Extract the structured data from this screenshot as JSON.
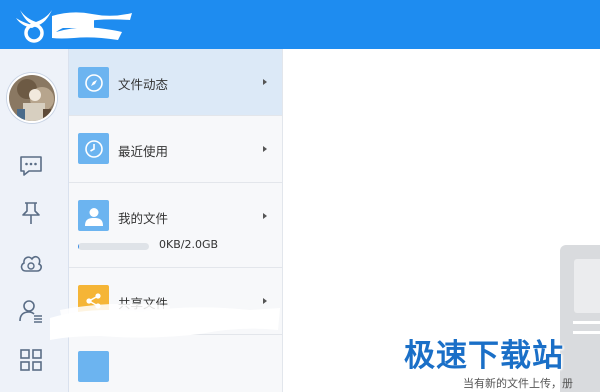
{
  "colors": {
    "accent": "#1e8cf0",
    "tile_blue": "#6cb4f0",
    "tile_orange": "#f5b536",
    "active_item_bg": "#dce9f7",
    "watermark": "#1a6fc7"
  },
  "header": {
    "logo_icon": "wings-logo-icon",
    "redacted_title": ""
  },
  "rail": {
    "avatar": "user-avatar",
    "buttons": [
      {
        "icon": "message-icon"
      },
      {
        "icon": "pin-icon"
      },
      {
        "icon": "cloud-icon"
      },
      {
        "icon": "contacts-icon"
      },
      {
        "icon": "apps-grid-icon"
      }
    ]
  },
  "menu": {
    "items": [
      {
        "label": "文件动态",
        "icon": "compass-icon",
        "active": true
      },
      {
        "label": "最近使用",
        "icon": "clock-icon",
        "active": false
      },
      {
        "label": "我的文件",
        "icon": "user-icon",
        "active": false
      },
      {
        "label": "共享文件",
        "icon": "share-icon",
        "active": false
      }
    ],
    "storage": {
      "usage_text": "0KB/2.0GB",
      "fraction_used": 0.02
    }
  },
  "main": {
    "watermark": "极速下载站",
    "status": "当有新的文件上传，册"
  }
}
